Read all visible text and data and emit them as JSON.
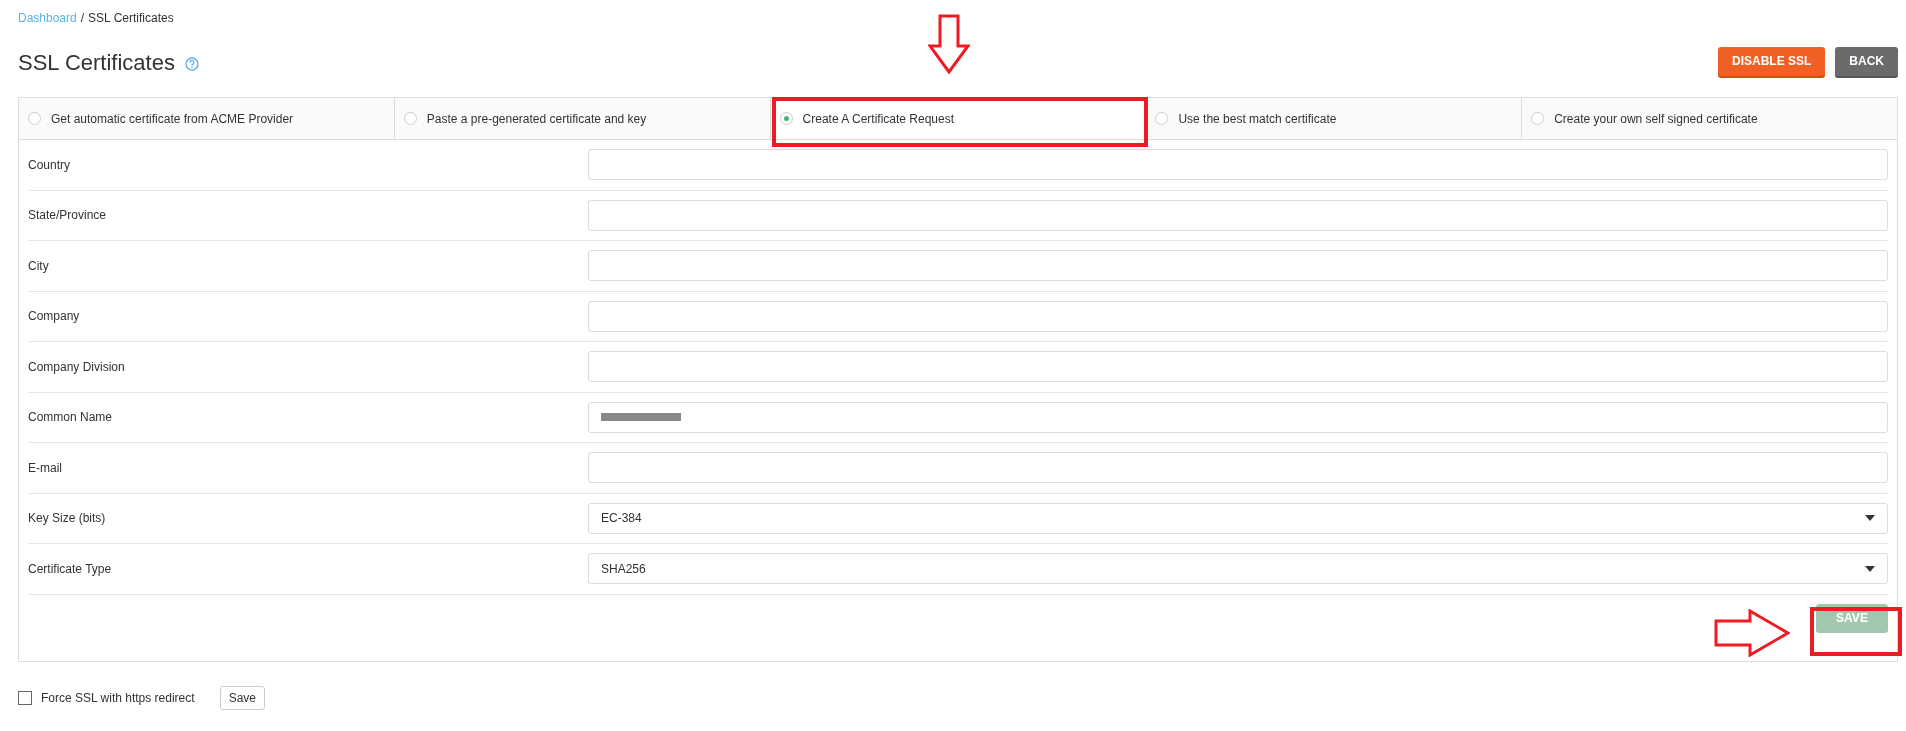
{
  "breadcrumb": {
    "link": "Dashboard",
    "separator": "/",
    "current": "SSL Certificates"
  },
  "title": "SSL Certificates",
  "header_buttons": [
    {
      "label": "DISABLE SSL",
      "kind": "danger"
    },
    {
      "label": "BACK",
      "kind": "neutral"
    }
  ],
  "tabs": [
    {
      "label": "Get automatic certificate from ACME Provider",
      "selected": false
    },
    {
      "label": "Paste a pre-generated certificate and key",
      "selected": false
    },
    {
      "label": "Create A Certificate Request",
      "selected": true
    },
    {
      "label": "Use the best match certificate",
      "selected": false
    },
    {
      "label": "Create your own self signed certificate",
      "selected": false
    }
  ],
  "fields": [
    {
      "label": "Country",
      "kind": "text"
    },
    {
      "label": "State/Province",
      "kind": "text"
    },
    {
      "label": "City",
      "kind": "text"
    },
    {
      "label": "Company",
      "kind": "text"
    },
    {
      "label": "Company Division",
      "kind": "text"
    },
    {
      "label": "Common Name",
      "kind": "redacted"
    },
    {
      "label": "E-mail",
      "kind": "text"
    },
    {
      "label": "Key Size (bits)",
      "kind": "select",
      "value": "EC-384"
    },
    {
      "label": "Certificate Type",
      "kind": "select",
      "value": "SHA256"
    }
  ],
  "save_button": {
    "label": "SAVE",
    "disabled": true
  },
  "force_ssl": {
    "label": "Force SSL with https redirect",
    "checked": false,
    "button": "Save"
  }
}
